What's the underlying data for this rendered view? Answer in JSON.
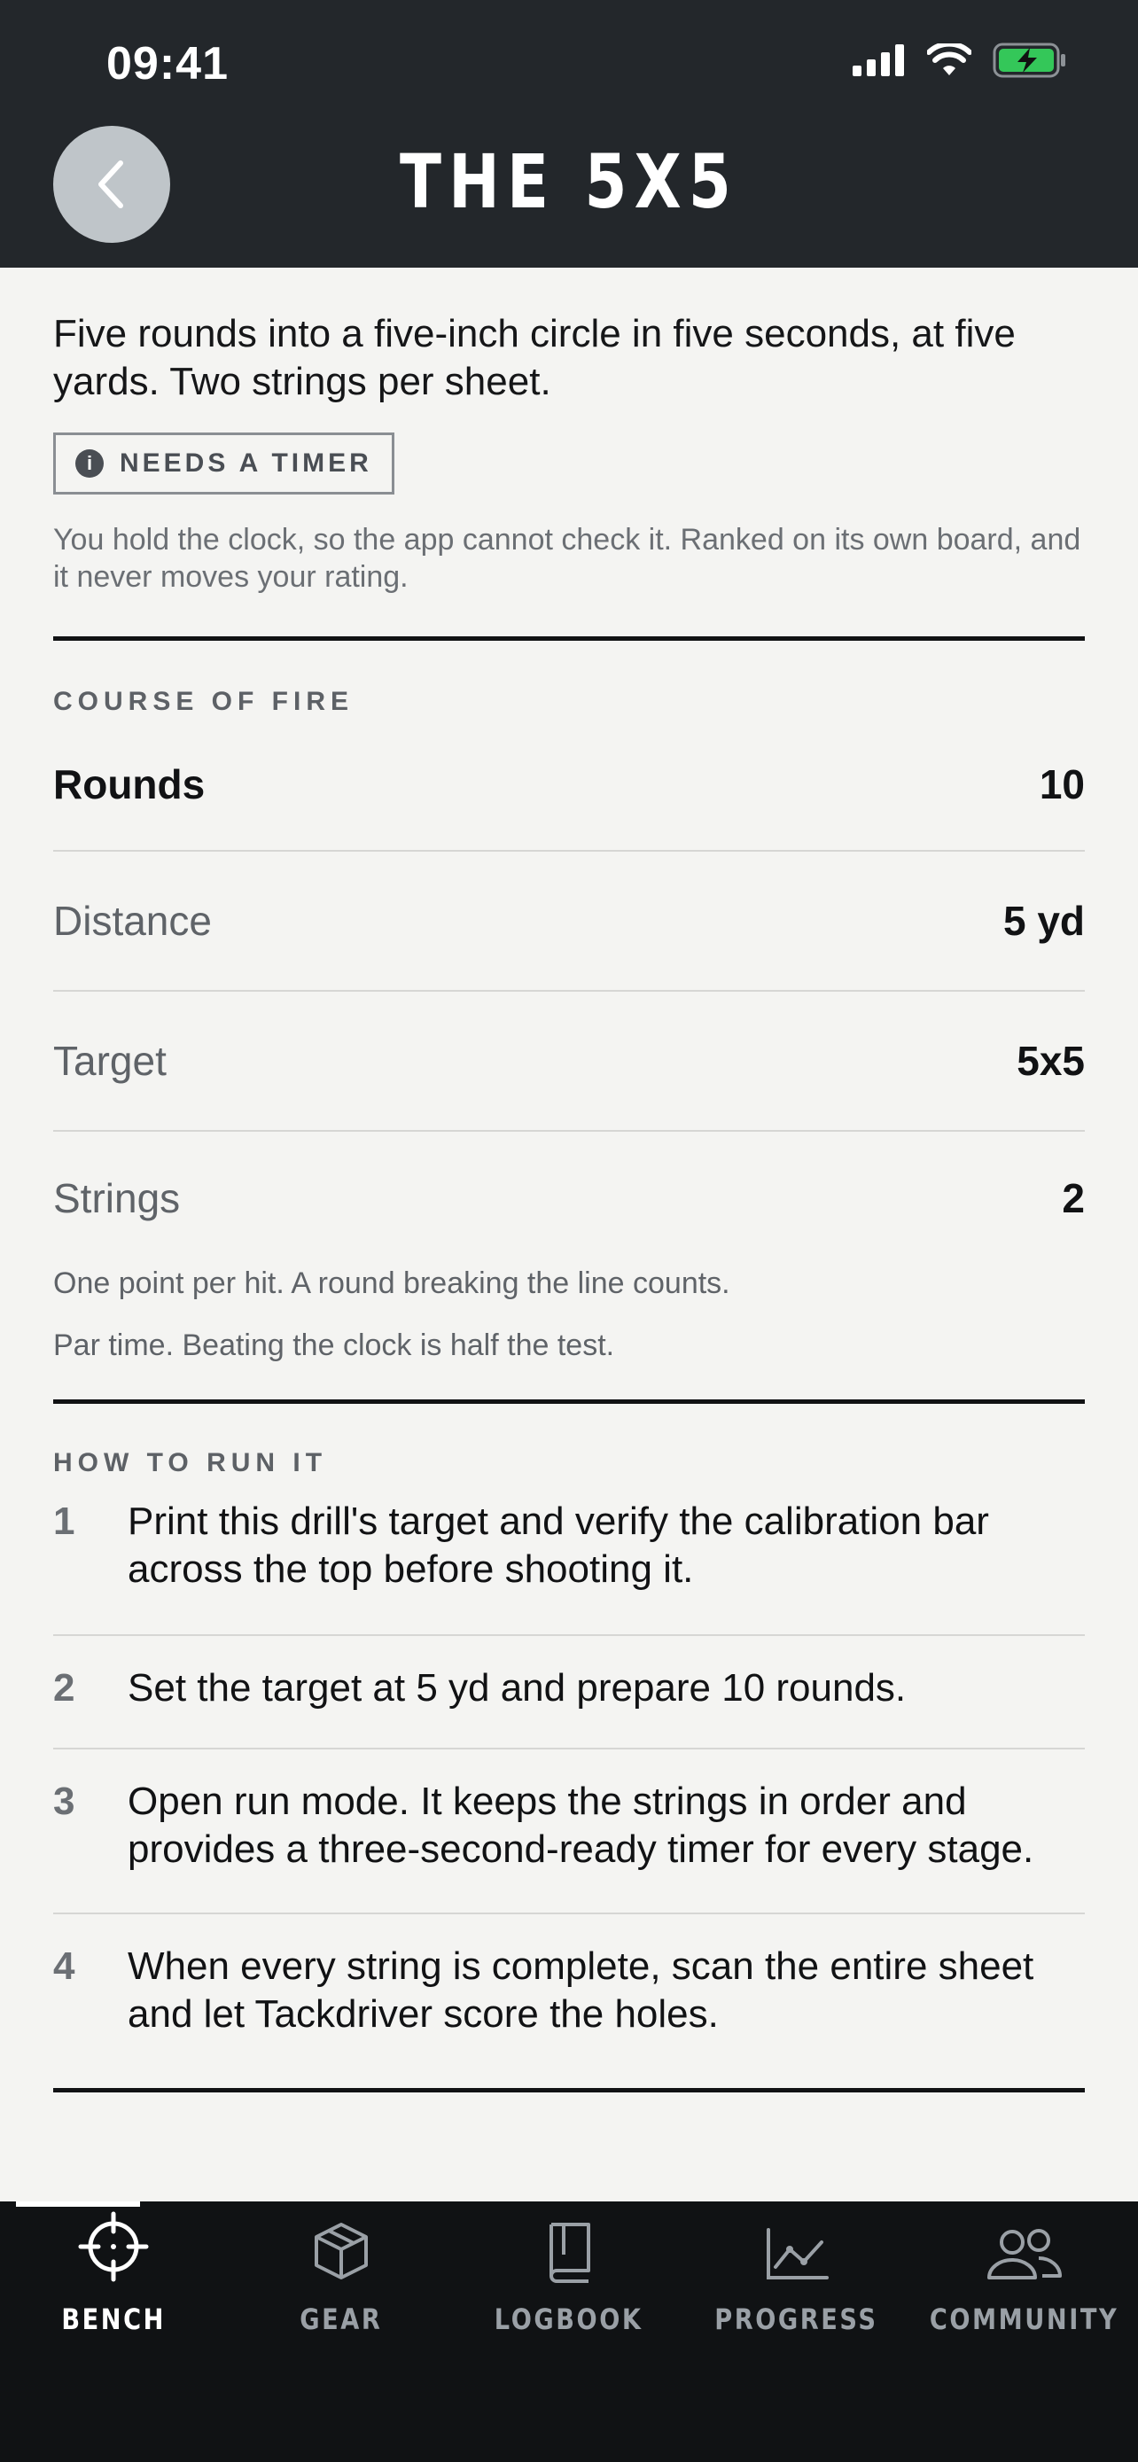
{
  "status_bar": {
    "time": "09:41"
  },
  "header": {
    "title": "THE 5X5"
  },
  "intro": "Five rounds into a five-inch circle in five seconds, at five yards. Two strings per sheet.",
  "badge": {
    "icon_glyph": "i",
    "label": "NEEDS A TIMER"
  },
  "timer_note": "You hold the clock, so the app cannot check it. Ranked on its own board, and it never moves your rating.",
  "course_of_fire": {
    "heading": "COURSE OF FIRE",
    "rows": [
      {
        "label": "Rounds",
        "value": "10"
      },
      {
        "label": "Distance",
        "value": "5 yd"
      },
      {
        "label": "Target",
        "value": "5x5"
      },
      {
        "label": "Strings",
        "value": "2"
      }
    ],
    "notes": [
      "One point per hit. A round breaking the line counts.",
      "Par time. Beating the clock is half the test."
    ]
  },
  "how_to_run": {
    "heading": "HOW TO RUN IT",
    "steps": [
      {
        "num": "1",
        "text": "Print this drill's target and verify the calibration bar across the top before shooting it."
      },
      {
        "num": "2",
        "text": "Set the target at 5 yd and prepare 10 rounds."
      },
      {
        "num": "3",
        "text": "Open run mode. It keeps the strings in order and provides a three-second-ready timer for every stage."
      },
      {
        "num": "4",
        "text": "When every string is complete, scan the entire sheet and let Tackdriver score the holes."
      }
    ]
  },
  "tabbar": {
    "active": "bench",
    "tabs": [
      {
        "id": "bench",
        "label": "BENCH",
        "icon": "crosshair-icon"
      },
      {
        "id": "gear",
        "label": "GEAR",
        "icon": "box-icon"
      },
      {
        "id": "logbook",
        "label": "LOGBOOK",
        "icon": "book-icon"
      },
      {
        "id": "progress",
        "label": "PROGRESS",
        "icon": "line-chart-icon"
      },
      {
        "id": "community",
        "label": "COMMUNITY",
        "icon": "users-icon"
      }
    ]
  },
  "colors": {
    "header_bg": "#23272b",
    "page_bg": "#f4f4f2",
    "tabbar_bg": "#101214",
    "battery": "#34c759"
  }
}
